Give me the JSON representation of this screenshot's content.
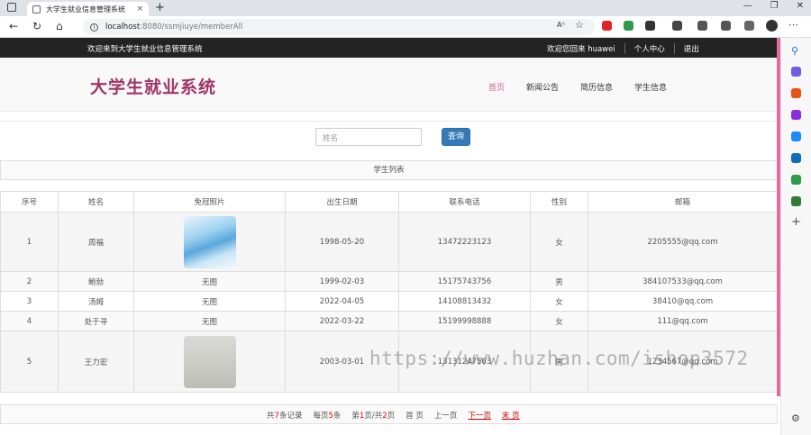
{
  "browser": {
    "tab_title": "大学生就业信息管理系统",
    "tab_close": "×",
    "new_tab": "+",
    "url_host": "localhost",
    "url_rest": ":8080/ssmjiuye/memberAll",
    "reader_label": "Aᴬ",
    "min": "—",
    "max": "❐",
    "close": "✕",
    "ext_colors": [
      "#e02424",
      "#2e9b4a",
      "#333333",
      "#444444",
      "#555555",
      "#555555",
      "#666666"
    ],
    "side_colors": [
      "#1a73e8",
      "#6e5ce6",
      "#e8531a",
      "#8a2be2",
      "#1a8cff",
      "#0f6cbd",
      "#2e9b4a",
      "#2e7d32"
    ]
  },
  "topbar": {
    "welcome": "欢迎来到大学生就业信息管理系统",
    "greeting": "欢迎您回来 huawei",
    "personal": "个人中心",
    "logout": "退出"
  },
  "header": {
    "logo": "大学生就业系统",
    "menu": [
      "首页",
      "新闻公告",
      "简历信息",
      "学生信息"
    ]
  },
  "search": {
    "placeholder": "姓名",
    "button": "查询"
  },
  "list": {
    "title": "学生列表",
    "columns": [
      "序号",
      "姓名",
      "免冠照片",
      "出生日期",
      "联系电话",
      "性别",
      "邮箱"
    ],
    "rows": [
      {
        "no": "1",
        "name": "周福",
        "photo": "",
        "birth": "1998-05-20",
        "phone": "13472223123",
        "gender": "女",
        "email": "2205555@qq.com"
      },
      {
        "no": "2",
        "name": "鲍勃",
        "photo": "无图",
        "birth": "1999-02-03",
        "phone": "15175743756",
        "gender": "男",
        "email": "384107533@qq.com"
      },
      {
        "no": "3",
        "name": "汤姆",
        "photo": "无图",
        "birth": "2022-04-05",
        "phone": "14108813432",
        "gender": "女",
        "email": "38410@qq.com"
      },
      {
        "no": "4",
        "name": "处于寻",
        "photo": "无图",
        "birth": "2022-03-22",
        "phone": "15199998888",
        "gender": "女",
        "email": "111@qq.com"
      },
      {
        "no": "5",
        "name": "王力宏",
        "photo": "",
        "birth": "2003-03-01",
        "phone": "13131247563",
        "gender": "男",
        "email": "1234567@qq.com"
      }
    ]
  },
  "pager": {
    "total_prefix": "共",
    "total": "7",
    "total_suffix": "条记录",
    "per_prefix": "每页",
    "per": "5",
    "per_suffix": "条",
    "page_prefix": "第",
    "page": "1",
    "page_mid": "页/共",
    "pages": "2",
    "page_suffix": "页",
    "first": "首 页",
    "prev": "上一页",
    "next": "下一页",
    "last": "末 页"
  },
  "watermark": "https://www.huzhan.com/ishop3572"
}
